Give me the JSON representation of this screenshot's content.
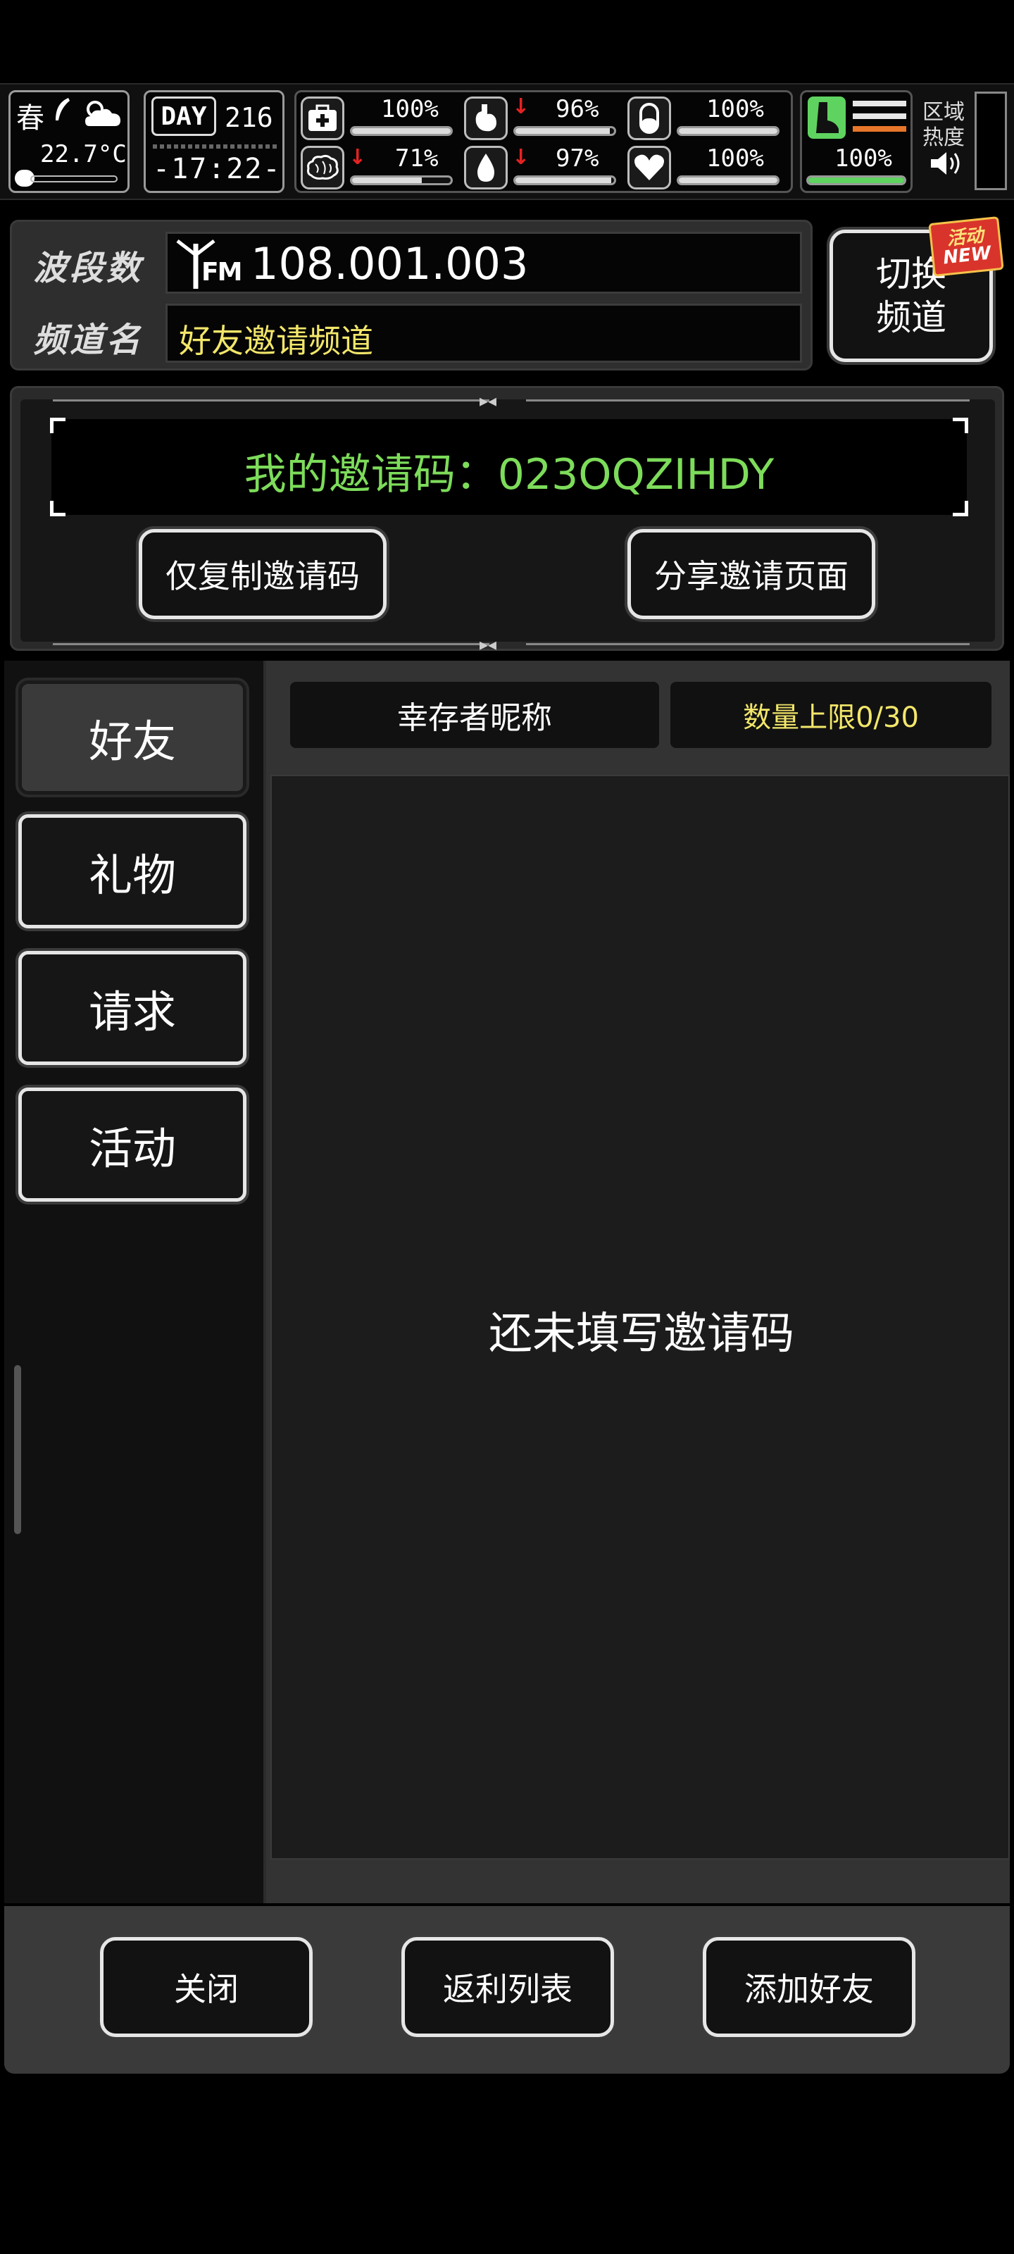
{
  "hud": {
    "season": "春",
    "temperature": "22.7°C",
    "day_label": "DAY",
    "day_number": "216",
    "time": "-17:22-",
    "stats": [
      {
        "icon": "medkit-icon",
        "value": "100%",
        "level": 1.0,
        "down": false
      },
      {
        "icon": "stomach-icon",
        "value": "96%",
        "level": 0.96,
        "down": true
      },
      {
        "icon": "pill-icon",
        "value": "100%",
        "level": 1.0,
        "down": false
      },
      {
        "icon": "brain-icon",
        "value": "71%",
        "level": 0.71,
        "down": true
      },
      {
        "icon": "water-drop-icon",
        "value": "97%",
        "level": 0.97,
        "down": true
      },
      {
        "icon": "heart-icon",
        "value": "100%",
        "level": 1.0,
        "down": false
      }
    ],
    "stamina": {
      "value": "100%",
      "level": 1.0
    },
    "region_heat_label_1": "区域",
    "region_heat_label_2": "热度"
  },
  "channel": {
    "band_label": "波段数",
    "band_value": "108.001.003",
    "fm_label": "FM",
    "name_label": "频道名",
    "name_value": "好友邀请频道",
    "switch_line1": "切换",
    "switch_line2": "频道",
    "badge_line1": "活动",
    "badge_line2": "NEW"
  },
  "invite": {
    "code_text": "我的邀请码：023OQZIHDY",
    "copy_button": "仅复制邀请码",
    "share_button": "分享邀请页面"
  },
  "tabs": [
    {
      "label": "好友",
      "active": true
    },
    {
      "label": "礼物",
      "active": false
    },
    {
      "label": "请求",
      "active": false
    },
    {
      "label": "活动",
      "active": false
    }
  ],
  "list": {
    "column_nickname": "幸存者昵称",
    "column_limit": "数量上限0/30",
    "empty_message": "还未填写邀请码"
  },
  "footer": {
    "close": "关闭",
    "rebate_list": "返利列表",
    "add_friend": "添加好友"
  },
  "colors": {
    "code_green": "#7ddc5a",
    "name_yellow": "#f2e66a",
    "limit_yellow": "#f2e66a",
    "arrow_red": "#e52222",
    "stamina_green": "#5fd35f",
    "badge_red": "#d9342b"
  }
}
